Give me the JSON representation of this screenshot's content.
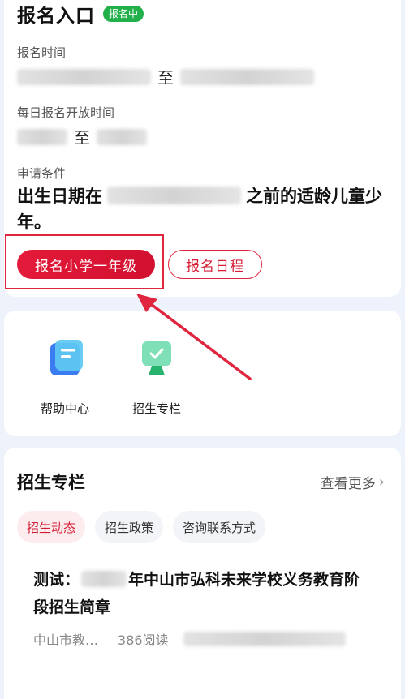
{
  "registration": {
    "title": "报名入口",
    "status_badge": "报名中",
    "time_label": "报名时间",
    "time_separator": "至",
    "daily_label": "每日报名开放时间",
    "daily_separator": "至",
    "condition_label": "申请条件",
    "condition_prefix": "出生日期在",
    "condition_suffix": "之前的适龄儿童少年。",
    "primary_button": "报名小学一年级",
    "schedule_button": "报名日程"
  },
  "quick_links": [
    {
      "label": "帮助中心",
      "icon": "help-center-icon"
    },
    {
      "label": "招生专栏",
      "icon": "enrollment-column-icon"
    }
  ],
  "column": {
    "title": "招生专栏",
    "more_label": "查看更多",
    "tabs": [
      {
        "label": "招生动态",
        "active": true
      },
      {
        "label": "招生政策",
        "active": false
      },
      {
        "label": "咨询联系方式",
        "active": false
      }
    ],
    "article": {
      "title_prefix": "测试：",
      "title_suffix": "年中山市弘科未来学校义务教育阶段招生简章",
      "source": "中山市教…",
      "reads": "386阅读"
    }
  },
  "colors": {
    "accent_red": "#e0253f",
    "badge_green": "#22b04b",
    "background": "#eef2fa"
  }
}
